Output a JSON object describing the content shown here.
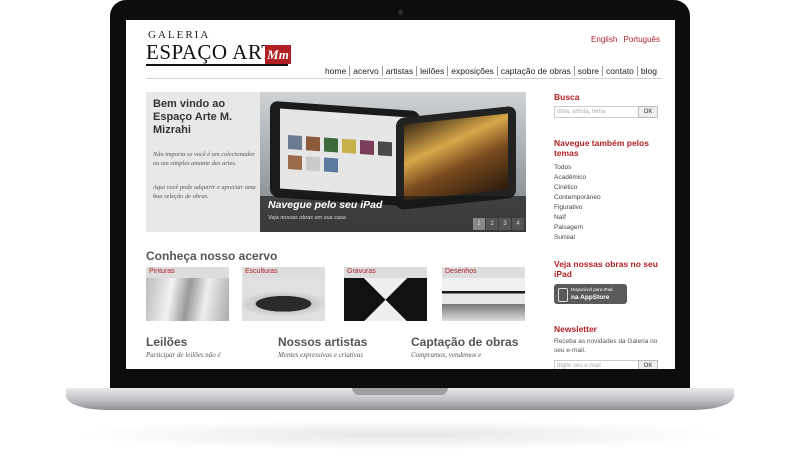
{
  "site": {
    "logo_top": "GALERIA",
    "logo_main": "ESPAÇO ARTE",
    "logo_mark": "Mm"
  },
  "languages": [
    "English",
    "Português"
  ],
  "nav": [
    "home",
    "acervo",
    "artistas",
    "leilões",
    "exposições",
    "captação de obras",
    "sobre",
    "contato",
    "blog"
  ],
  "welcome": {
    "title": "Bem vindo ao Espaço Arte M. Mizrahi",
    "p1": "Não importa se você é um colecionador ou um simples amante das artes.",
    "p2": "Aqui você pode adquirir e apreciar uma boa seleção de obras."
  },
  "slider": {
    "title": "Navegue pelo seu iPad",
    "subtitle": "Veja nossas obras em sua casa",
    "pages": [
      "1",
      "2",
      "3",
      "4"
    ]
  },
  "acervo": {
    "title": "Conheça nosso acervo",
    "categories": [
      "Pinturas",
      "Esculturas",
      "Gravuras",
      "Desenhos"
    ]
  },
  "columns": [
    {
      "title": "Leilões",
      "text": "Participar de leilões não é"
    },
    {
      "title": "Nossos artistas",
      "text": "Mentes expressivas e criativas"
    },
    {
      "title": "Captação de obras",
      "text": "Compramos, vendemos e"
    }
  ],
  "sidebar": {
    "search_title": "Busca",
    "search_placeholder": "obra, artista, tema",
    "ok_label": "OK",
    "themes_title": "Navegue também pelos temas",
    "themes": [
      "Todos",
      "Acadêmico",
      "Cinético",
      "Contemporâneo",
      "Figurativo",
      "Naïf",
      "Paisagem",
      "Surreal"
    ],
    "ipad_title": "Veja nossas obras no seu iPad",
    "appstore_line1": "Disponível para iPad",
    "appstore_line2": "na AppStore",
    "newsletter_title": "Newsletter",
    "newsletter_text": "Receba as novidades da Galeria no seu e-mail.",
    "email_placeholder": "digite seu e-mail"
  }
}
